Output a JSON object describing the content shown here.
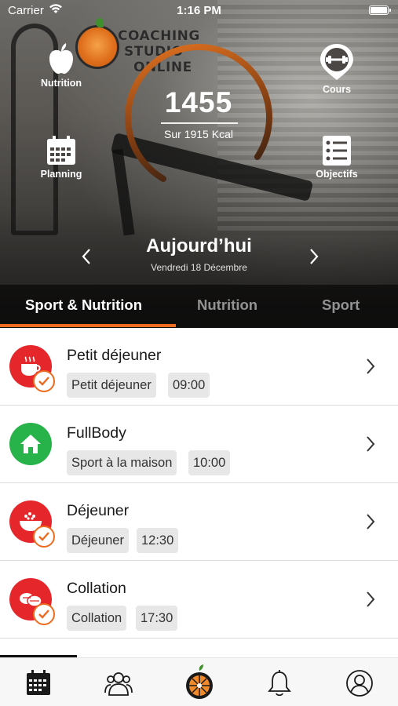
{
  "status_bar": {
    "carrier": "Carrier",
    "time": "1:16 PM"
  },
  "logo": {
    "line1": "COACHING",
    "line2": "STUDIO",
    "line3": "ONLINE"
  },
  "hero_actions": {
    "nutrition": "Nutrition",
    "cours": "Cours",
    "planning": "Planning",
    "objectifs": "Objectifs"
  },
  "calories": {
    "consumed": "1455",
    "target_label": "Sur 1915 Kcal",
    "progress_fraction": 0.76
  },
  "date": {
    "title": "Aujourd’hui",
    "subtitle": "Vendredi 18 Décembre"
  },
  "tabs": [
    {
      "label": "Sport & Nutrition",
      "active": true
    },
    {
      "label": "Nutrition",
      "active": false
    },
    {
      "label": "Sport",
      "active": false
    }
  ],
  "items": [
    {
      "title": "Petit déjeuner",
      "tag": "Petit déjeuner",
      "time": "09:00",
      "icon": "coffee-cup-icon",
      "color": "#e5262a",
      "done": true
    },
    {
      "title": "FullBody",
      "tag": "Sport à la maison",
      "time": "10:00",
      "icon": "home-icon",
      "color": "#27b24a",
      "done": false
    },
    {
      "title": "Déjeuner",
      "tag": "Déjeuner",
      "time": "12:30",
      "icon": "salad-bowl-icon",
      "color": "#e5262a",
      "done": true
    },
    {
      "title": "Collation",
      "tag": "Collation",
      "time": "17:30",
      "icon": "snack-icon",
      "color": "#e5262a",
      "done": true
    }
  ],
  "bottom_nav": [
    "calendar-icon",
    "community-icon",
    "home-logo-icon",
    "bell-icon",
    "profile-icon"
  ],
  "colors": {
    "accent": "#ec6b1f",
    "meal_red": "#e5262a",
    "sport_green": "#27b24a"
  }
}
